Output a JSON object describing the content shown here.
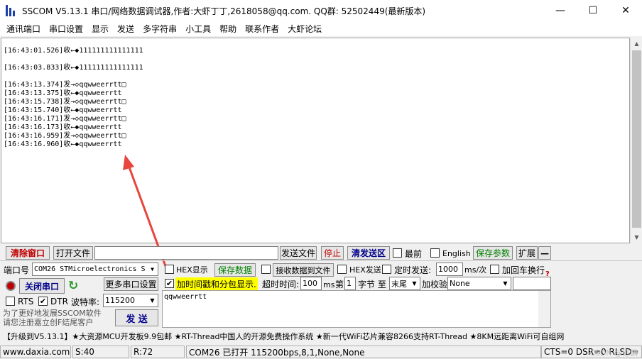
{
  "window": {
    "title": "SSCOM V5.13.1 串口/网络数据调试器,作者:大虾丁丁,2618058@qq.com. QQ群:  52502449(最新版本)",
    "minimize": "—",
    "maximize": "☐",
    "close": "✕"
  },
  "menu": [
    "通讯端口",
    "串口设置",
    "显示",
    "发送",
    "多字符串",
    "小工具",
    "帮助",
    "联系作者",
    "大虾论坛"
  ],
  "receive": {
    "lines": [
      "[16:43:01.526]收←◆111111111111111",
      "",
      "[16:43:03.833]收←◆111111111111111",
      "",
      "[16:43:13.374]发→◇qqwweerrtt□",
      "[16:43:13.375]收←◆qqwweerrtt",
      "[16:43:15.738]发→◇qqwweerrtt□",
      "[16:43:15.740]收←◆qqwweerrtt",
      "[16:43:16.171]发→◇qqwweerrtt□",
      "[16:43:16.173]收←◆qqwweerrtt",
      "[16:43:16.959]发→◇qqwweerrtt□",
      "[16:43:16.960]收←◆qqwweerrtt"
    ]
  },
  "toolbar1": {
    "clear_window": "清除窗口",
    "open_file": "打开文件",
    "file_path": "",
    "send_file": "发送文件",
    "stop": "停止",
    "clear_send": "清发送区",
    "topmost": "最前",
    "english": "English",
    "save_params": "保存参数",
    "expand": "扩展",
    "collapse": "—"
  },
  "toolbar2": {
    "port_label": "端口号",
    "port_value": "COM26 STMicroelectronics S",
    "hex_display": "HEX显示",
    "save_data": "保存数据",
    "recv_to_file": "接收数据到文件",
    "hex_send": "HEX发送",
    "timed_send": "定时发送:",
    "timed_value": "1000",
    "timed_unit": "ms/次",
    "add_crlf": "加回车换行",
    "help_mark": "?"
  },
  "toolbar3": {
    "close_port": "关闭串口",
    "more_settings": "更多串口设置",
    "timestamp": "加时间戳和分包显示.",
    "timeout_label": "超时时间:",
    "timeout_value": "100",
    "timeout_unit": "ms",
    "nth_label": "第",
    "nth_value": "1",
    "byte_label": "字节 至",
    "end_value": "末尾",
    "checksum_label": "加校验",
    "checksum_value": "None"
  },
  "toolbar4": {
    "rts": "RTS",
    "dtr": "DTR",
    "baud_label": "波特率:",
    "baud_value": "115200",
    "send": "发 送"
  },
  "send_text": "qqwweerrtt",
  "promo_left": "为了更好地发展SSCOM软件\n请您注册嘉立创F结尾客户",
  "adbar": "【升级到V5.13.1】★大资源MCU开发板9.9包邮 ★RT-Thread中国人的开源免费操作系统 ★新一代WiFi芯片兼容8266支持RT-Thread ★8KM远距离WiFi可自组网",
  "status": {
    "website": "www.daxia.com",
    "sent": "S:40",
    "received": "R:72",
    "port_state": "COM26 已打开  115200bps,8,1,None,None",
    "signals": "CTS=0 DSR=0 RLSD="
  },
  "watermark": "CSDN @订鹊"
}
